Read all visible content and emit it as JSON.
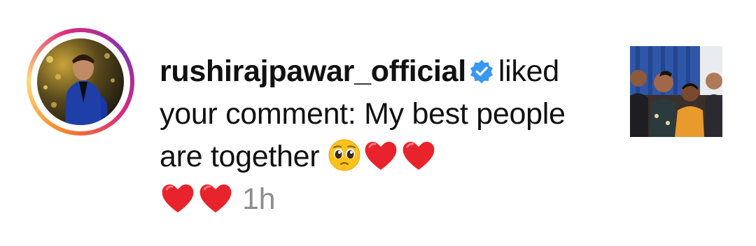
{
  "notification": {
    "username": "rushirajpawar_official",
    "verified_icon": "verified-badge-icon",
    "action_text": "liked your comment:",
    "comment_text": "My best people are together",
    "emojis": [
      "pleading-face-emoji",
      "red-heart-emoji",
      "red-heart-emoji",
      "red-heart-emoji",
      "red-heart-emoji"
    ],
    "timestamp": "1h"
  },
  "colors": {
    "text": "#111111",
    "timestamp": "#8e8e8e",
    "verified": "#3897f0",
    "ring_gradient": [
      "#f58529",
      "#feda77",
      "#dd2a7b",
      "#8134af"
    ]
  }
}
